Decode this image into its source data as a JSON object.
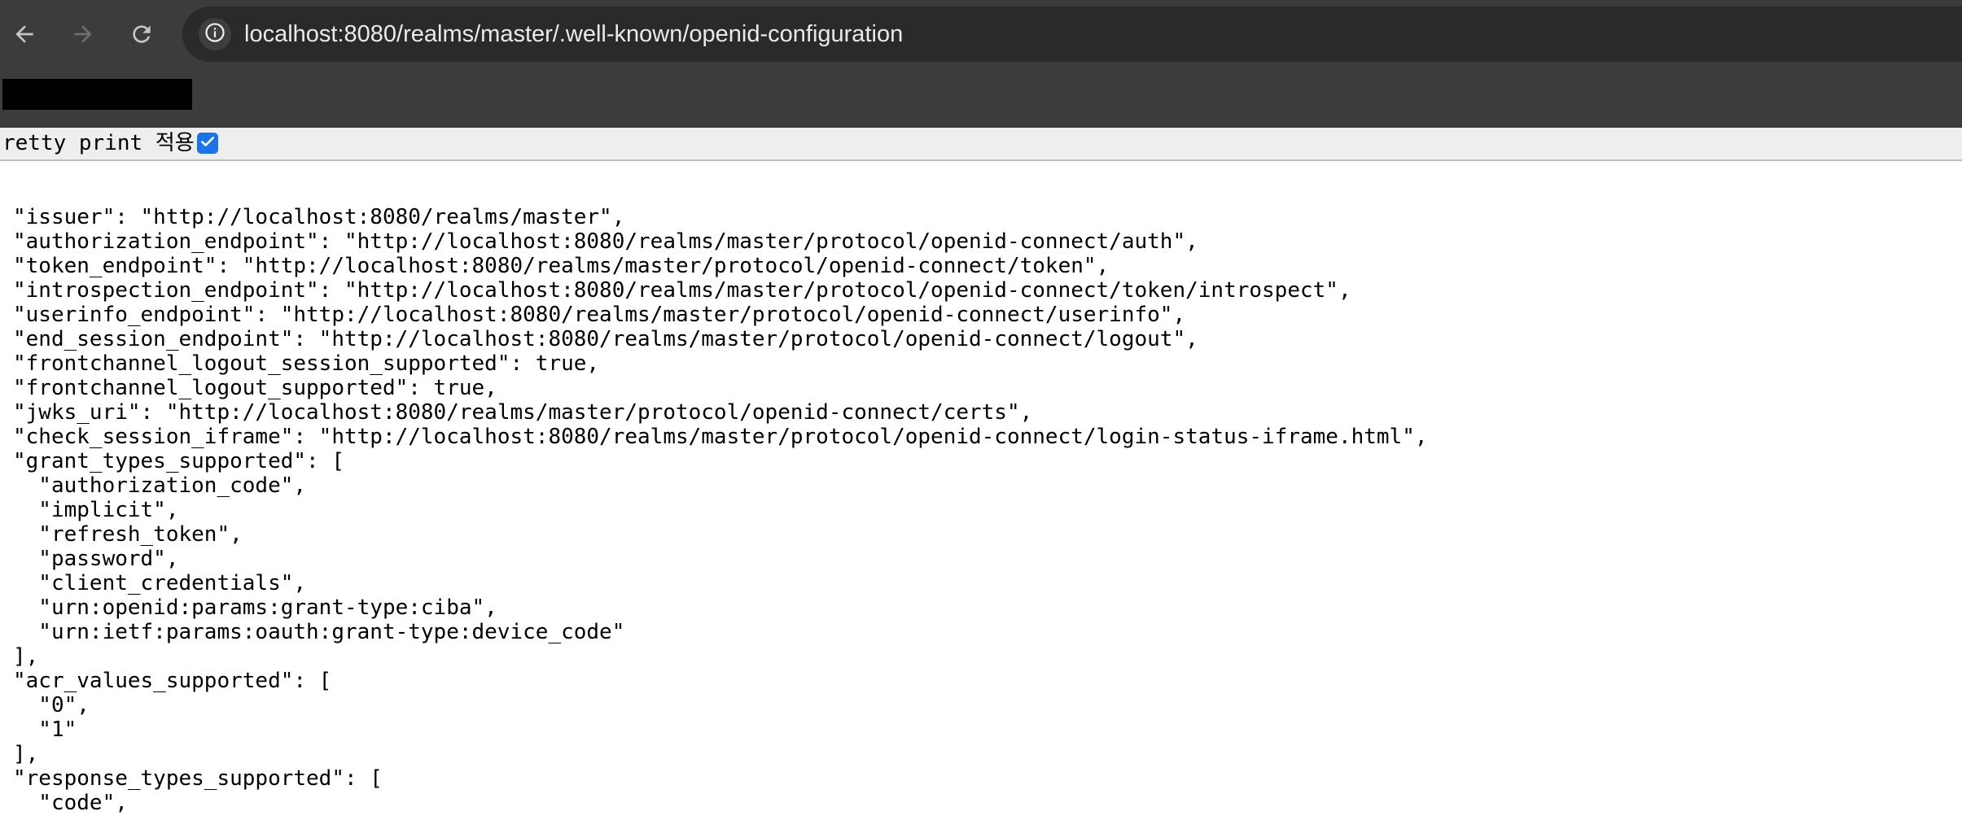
{
  "browser": {
    "url": "localhost:8080/realms/master/.well-known/openid-configuration",
    "back_icon": "arrow-left-icon",
    "forward_icon": "arrow-right-icon",
    "reload_icon": "reload-icon",
    "site_info_icon": "info-icon"
  },
  "pretty_print": {
    "label": "retty print 적용",
    "checked": true
  },
  "json_lines": [
    "\"issuer\": \"http://localhost:8080/realms/master\",",
    "\"authorization_endpoint\": \"http://localhost:8080/realms/master/protocol/openid-connect/auth\",",
    "\"token_endpoint\": \"http://localhost:8080/realms/master/protocol/openid-connect/token\",",
    "\"introspection_endpoint\": \"http://localhost:8080/realms/master/protocol/openid-connect/token/introspect\",",
    "\"userinfo_endpoint\": \"http://localhost:8080/realms/master/protocol/openid-connect/userinfo\",",
    "\"end_session_endpoint\": \"http://localhost:8080/realms/master/protocol/openid-connect/logout\",",
    "\"frontchannel_logout_session_supported\": true,",
    "\"frontchannel_logout_supported\": true,",
    "\"jwks_uri\": \"http://localhost:8080/realms/master/protocol/openid-connect/certs\",",
    "\"check_session_iframe\": \"http://localhost:8080/realms/master/protocol/openid-connect/login-status-iframe.html\",",
    "\"grant_types_supported\": [",
    "  \"authorization_code\",",
    "  \"implicit\",",
    "  \"refresh_token\",",
    "  \"password\",",
    "  \"client_credentials\",",
    "  \"urn:openid:params:grant-type:ciba\",",
    "  \"urn:ietf:params:oauth:grant-type:device_code\"",
    "],",
    "\"acr_values_supported\": [",
    "  \"0\",",
    "  \"1\"",
    "],",
    "\"response_types_supported\": [",
    "  \"code\","
  ]
}
